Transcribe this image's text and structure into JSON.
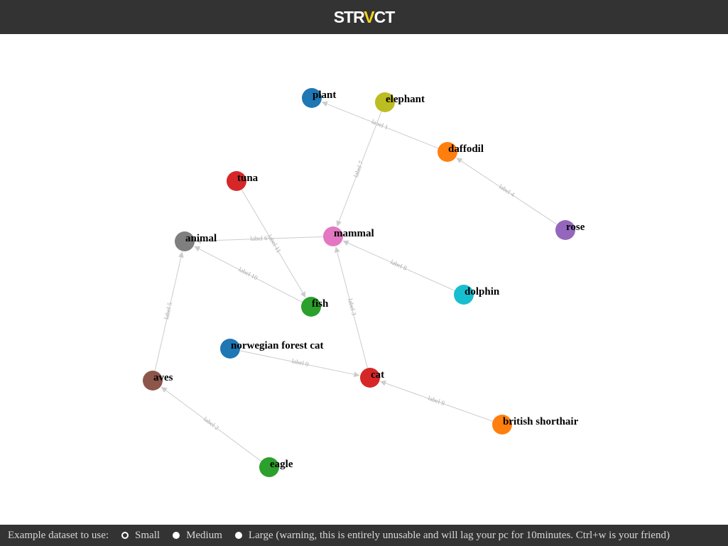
{
  "header": {
    "brand_prefix": "STR",
    "brand_accent": "V",
    "brand_suffix": "CT",
    "accent_color": "#f2d31b"
  },
  "graph": {
    "nodes": [
      {
        "id": "plant",
        "label": "plant",
        "color": "#1f77b4"
      },
      {
        "id": "elephant",
        "label": "elephant",
        "color": "#bcbd22"
      },
      {
        "id": "daffodil",
        "label": "daffodil",
        "color": "#ff7f0e"
      },
      {
        "id": "tuna",
        "label": "tuna",
        "color": "#d62728"
      },
      {
        "id": "animal",
        "label": "animal",
        "color": "#7f7f7f"
      },
      {
        "id": "mammal",
        "label": "mammal",
        "color": "#e377c2"
      },
      {
        "id": "rose",
        "label": "rose",
        "color": "#9467bd"
      },
      {
        "id": "dolphin",
        "label": "dolphin",
        "color": "#17becf"
      },
      {
        "id": "fish",
        "label": "fish",
        "color": "#2ca02c"
      },
      {
        "id": "norwegian_forest_cat",
        "label": "norwegian forest cat",
        "color": "#1f77b4"
      },
      {
        "id": "cat",
        "label": "cat",
        "color": "#d62728"
      },
      {
        "id": "aves",
        "label": "aves",
        "color": "#8c564b"
      },
      {
        "id": "british_shorthair",
        "label": "british shorthair",
        "color": "#ff7f0e"
      },
      {
        "id": "eagle",
        "label": "eagle",
        "color": "#2ca02c"
      }
    ],
    "edges": [
      {
        "source": "norwegian_forest_cat",
        "target": "cat",
        "label": "label 0"
      },
      {
        "source": "daffodil",
        "target": "plant",
        "label": "label 1"
      },
      {
        "source": "eagle",
        "target": "aves",
        "label": "label 2"
      },
      {
        "source": "cat",
        "target": "mammal",
        "label": "label 3"
      },
      {
        "source": "rose",
        "target": "daffodil",
        "label": "label 4"
      },
      {
        "source": "aves",
        "target": "animal",
        "label": "label 5"
      },
      {
        "source": "mammal",
        "target": "animal",
        "label": "label 6"
      },
      {
        "source": "elephant",
        "target": "mammal",
        "label": "label 7"
      },
      {
        "source": "dolphin",
        "target": "mammal",
        "label": "label 8"
      },
      {
        "source": "british_shorthair",
        "target": "cat",
        "label": "label 9"
      },
      {
        "source": "fish",
        "target": "animal",
        "label": "label 10"
      },
      {
        "source": "tuna",
        "target": "fish",
        "label": "label 11"
      }
    ]
  },
  "footer": {
    "prompt": "Example dataset to use:",
    "options": [
      {
        "label": "Small",
        "checked": true
      },
      {
        "label": "Medium",
        "checked": false
      },
      {
        "label": "Large (warning, this is entirely unusable and will lag your pc for 10minutes. Ctrl+w is your friend)",
        "checked": false
      }
    ]
  }
}
